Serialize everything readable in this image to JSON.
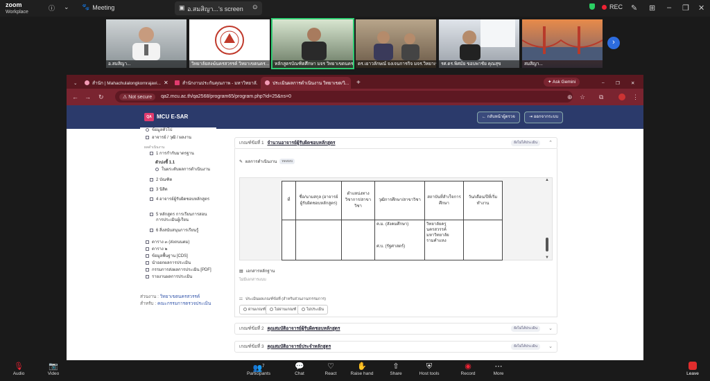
{
  "zoom": {
    "app_name": "zoom",
    "app_sub": "Workplace",
    "meeting_label": "Meeting",
    "share_label": "อ.สมสิญา...'s screen",
    "rec_label": "REC",
    "participants": [
      {
        "name": "อ.สมสิญา..."
      },
      {
        "name": "วิทยาลัยสงฆ์นครสวรรค์ วิทยาเขตนคร..."
      },
      {
        "name": "หลักสูตรบัณฑิตศึกษา มจร วิทยาเขตนครส..."
      },
      {
        "name": "ดร.เยาวลักษณ์ จงเจนการกิจ มจร.วิทยาเขตนค..."
      },
      {
        "name": "รศ.ดร.พิศมัย ขอบพาชัย คุณสุข"
      },
      {
        "name": "สมสิญา..."
      }
    ],
    "toolbar": {
      "audio": "Audio",
      "video": "Video",
      "participants": "Participants",
      "participants_count": "7",
      "chat": "Chat",
      "react": "React",
      "raise_hand": "Raise hand",
      "share": "Share",
      "host_tools": "Host tools",
      "record": "Record",
      "more": "More",
      "leave": "Leave"
    }
  },
  "browser": {
    "tabs": [
      {
        "label": "สำนัก | Mahachulalongkornrajavi..."
      },
      {
        "label": "สำนักงานประกันคุณภาพ - มหาวิทยาลั..."
      },
      {
        "label": "ประเมินผลการดำเนินงาน วิทยาเขต/วิ..."
      }
    ],
    "new_tab": "+",
    "ask_gemini": "Ask Gemini",
    "not_secure": "Not secure",
    "url": "qa2.mcu.ac.th/qa2568/program65/program.php?id=25&ns=0"
  },
  "site": {
    "logo": "QA",
    "title": "MCU E-SAR",
    "back_button": "กลับหน้าผู้ตรวจ",
    "logout_button": "ออกจากระบบ",
    "sidebar": {
      "top_items": [
        {
          "label": "ข้อมูลทั่วไป"
        },
        {
          "label": "อาจารย์ / วุฒิ / ผลงาน"
        }
      ],
      "section_label": "ผลดำเนินงาน",
      "standard_1": "1 การกำกับมาตรฐาน",
      "indicator_1_1": "ตัวบ่งชี้ 1.1",
      "indicator_1_1_sub": "ในผระดับผลการดำเนินงาน",
      "items": [
        {
          "label": "2 บัณฑิต"
        },
        {
          "label": "3 นิสิต"
        },
        {
          "label": "4 อาจารย์ผู้รับผิดชอบหลักสูตร"
        },
        {
          "label": "5 หลักสูตร การเรียนการสอน การประเมินผู้เรียน"
        },
        {
          "label": "6 สิ่งสนับสนุนการเรียนรู้"
        }
      ],
      "bottom_items": [
        {
          "label": "ตาราง ๓ (ส่งถนนตม)"
        },
        {
          "label": "ตาราง ๒"
        },
        {
          "label": "ข้อมูลพื้นฐาน [CDS]"
        },
        {
          "label": "นำออกผลการประเมิน"
        },
        {
          "label": "กรรมการส่งผลการประเมิน [PDF]"
        },
        {
          "label": "รายงานผลการประเมิน"
        }
      ],
      "footer_unit_label": "ส่วนงาน :",
      "footer_unit_value": "วิทยาเขตนครสวรรค์",
      "footer_role_label": "สำหรับ :",
      "footer_role_value": "คณะกรรมการตรวจประเมิน"
    },
    "main": {
      "criteria": [
        {
          "prefix": "เกณฑ์ข้อที่ 1",
          "title": "จำนวนอาจารย์ผู้รับผิดชอบหลักสูตร",
          "badge": "ยังไม่ได้ประเมิน"
        },
        {
          "prefix": "เกณฑ์ข้อที่ 2",
          "title": "คุณสมบัติอาจารย์ผู้รับผิดชอบหลักสูตร",
          "badge": "ยังไม่ได้ประเมิน"
        },
        {
          "prefix": "เกณฑ์ข้อที่ 3",
          "title": "คุณสมบัติอาจารย์ประจำหลักสูตร",
          "badge": "ยังไม่ได้ประเมิน"
        }
      ],
      "results_label": "ผลการดำเนินงาน",
      "results_badge": "ทดสอบ",
      "table_headers": [
        "ที่",
        "ชื่อ/นามสกุล (อาจารย์ผู้รับผิดชอบหลักสูตร)",
        "ตำแหน่งทางวิชาการ/สาขาวิชา",
        "วุฒิการศึกษา/สาขาวิชา",
        "สถาบันที่สำเร็จการศึกษา",
        "วัน/เดือน/ปีที่เริ่มทำงาน"
      ],
      "table_row": {
        "no": "",
        "name": "",
        "position": "",
        "degree": "ค.ม. (สังคมศึกษา)\n\n\n\nศ.บ. (รัฐศาสตร์)",
        "institution": "วิทยาลัยครู นครสวรรค์ มหาวิทยาลัย รามคำแหง",
        "start_date": ""
      },
      "docs_label": "เอกสารหลักฐาน",
      "docs_empty": "ไม่มีเอกสารแนบ",
      "eval_label": "ประเมินผลเกณฑ์ข้อที่ (สำหรับส่วนงาน/กรรมการ)",
      "eval_options": [
        "ผ่านเกณฑ์",
        "ไม่ผ่านเกณฑ์",
        "ไม่ประเมิน"
      ]
    }
  }
}
